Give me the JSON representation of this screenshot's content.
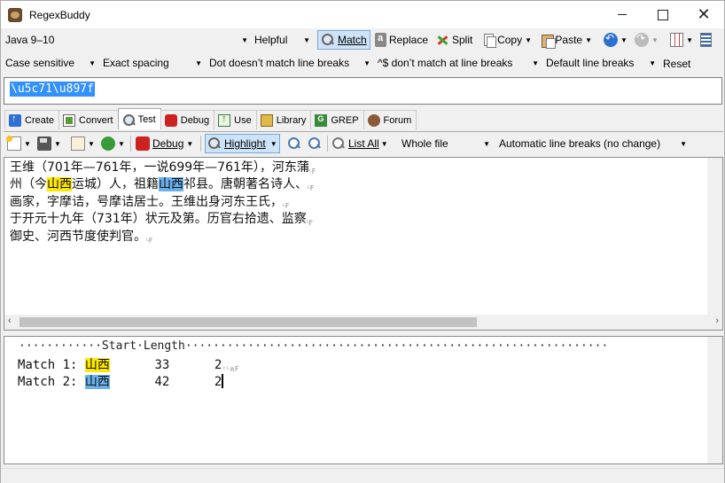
{
  "window": {
    "title": "RegexBuddy"
  },
  "toolbar1": {
    "flavor": "Java 9–10",
    "application": "Helpful",
    "match_label": "Match",
    "replace_label": "Replace",
    "split_label": "Split",
    "copy_label": "Copy",
    "paste_label": "Paste"
  },
  "options": {
    "case": "Case sensitive",
    "spacing": "Exact spacing",
    "dot": "Dot doesn’t match line breaks",
    "anchors": "^$ don’t match at line breaks",
    "line_breaks": "Default line breaks",
    "reset_label": "Reset"
  },
  "regex": {
    "text": "\\u5c71\\u897f"
  },
  "tabs": [
    {
      "label": "Create"
    },
    {
      "label": "Convert"
    },
    {
      "label": "Test"
    },
    {
      "label": "Debug"
    },
    {
      "label": "Use"
    },
    {
      "label": "Library"
    },
    {
      "label": "GREP"
    },
    {
      "label": "Forum"
    }
  ],
  "test_toolbar": {
    "debug_label": "Debug",
    "highlight_label": "Highlight",
    "list_all_label": "List All",
    "scope": "Whole file",
    "line_breaks": "Automatic line breaks (no change)"
  },
  "test_text": {
    "line1": "王维（701年—761年，一说699年—761年），河东蒲",
    "line2_a": "州（今",
    "line2_m1": "山西",
    "line2_b": "运城）人，祖籍",
    "line2_m2": "山西",
    "line2_c": "祁县。唐朝著名诗人、",
    "line3": "画家，字摩诘，号摩诘居士。王维出身河东王氏，",
    "line4": "于开元十九年（731年）状元及第。历官右拾遗、监察",
    "line5": "御史、河西节度使判官。",
    "eol_lf": "ᴸF",
    "eol_crlf": "ᶜᴸʀF"
  },
  "results": {
    "header": "············Start·Length·····························································",
    "matches": [
      {
        "label": "Match 1:",
        "text": "山西",
        "start": "33",
        "length": "2"
      },
      {
        "label": "Match 2:",
        "text": "山西",
        "start": "42",
        "length": "2"
      }
    ]
  },
  "colors": {
    "match1": "#ffe800",
    "match2": "#6ab1ec",
    "selection": "#3390ff"
  }
}
